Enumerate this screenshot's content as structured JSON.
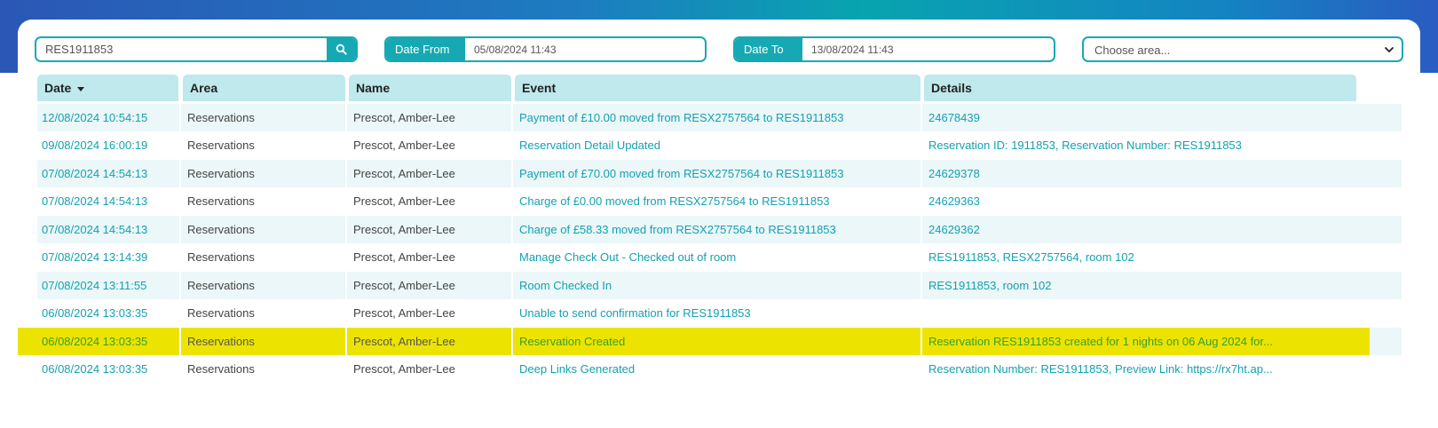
{
  "filters": {
    "search_value": "RES1911853",
    "search_button_icon": "search-icon",
    "date_from_label": "Date From",
    "date_from_value": "05/08/2024 11:43",
    "date_to_label": "Date To",
    "date_to_value": "13/08/2024 11:43",
    "area_placeholder": "Choose area..."
  },
  "table": {
    "columns": [
      "Date",
      "Area",
      "Name",
      "Event",
      "Details"
    ],
    "sort_column": "Date",
    "sort_direction": "desc",
    "highlighted_row": 8,
    "rows": [
      {
        "date": "12/08/2024 10:54:15",
        "area": "Reservations",
        "name": "Prescot, Amber-Lee",
        "event": "Payment of £10.00 moved from RESX2757564 to RES1911853",
        "details": "24678439"
      },
      {
        "date": "09/08/2024 16:00:19",
        "area": "Reservations",
        "name": "Prescot, Amber-Lee",
        "event": "Reservation Detail Updated",
        "details": "Reservation ID: 1911853, Reservation Number: RES1911853"
      },
      {
        "date": "07/08/2024 14:54:13",
        "area": "Reservations",
        "name": "Prescot, Amber-Lee",
        "event": "Payment of £70.00 moved from RESX2757564 to RES1911853",
        "details": "24629378"
      },
      {
        "date": "07/08/2024 14:54:13",
        "area": "Reservations",
        "name": "Prescot, Amber-Lee",
        "event": "Charge of £0.00 moved from RESX2757564 to RES1911853",
        "details": "24629363"
      },
      {
        "date": "07/08/2024 14:54:13",
        "area": "Reservations",
        "name": "Prescot, Amber-Lee",
        "event": "Charge of £58.33 moved from RESX2757564 to RES1911853",
        "details": "24629362"
      },
      {
        "date": "07/08/2024 13:14:39",
        "area": "Reservations",
        "name": "Prescot, Amber-Lee",
        "event": "Manage Check Out - Checked out of room",
        "details": "RES1911853, RESX2757564, room 102"
      },
      {
        "date": "07/08/2024 13:11:55",
        "area": "Reservations",
        "name": "Prescot, Amber-Lee",
        "event": "Room Checked In",
        "details": "RES1911853, room 102"
      },
      {
        "date": "06/08/2024 13:03:35",
        "area": "Reservations",
        "name": "Prescot, Amber-Lee",
        "event": "Unable to send confirmation for RES1911853",
        "details": ""
      },
      {
        "date": "06/08/2024 13:03:35",
        "area": "Reservations",
        "name": "Prescot, Amber-Lee",
        "event": "Reservation Created",
        "details": "Reservation RES1911853 created for 1 nights on 06 Aug 2024 for..."
      },
      {
        "date": "06/08/2024 13:03:35",
        "area": "Reservations",
        "name": "Prescot, Amber-Lee",
        "event": "Deep Links Generated",
        "details": "Reservation Number: RES1911853, Preview Link: https://rx7ht.ap..."
      }
    ]
  },
  "colors": {
    "accent": "#17a9b3",
    "header_bg": "#bfe9ec",
    "link_text": "#14a1b2",
    "highlight": "#ece400"
  }
}
